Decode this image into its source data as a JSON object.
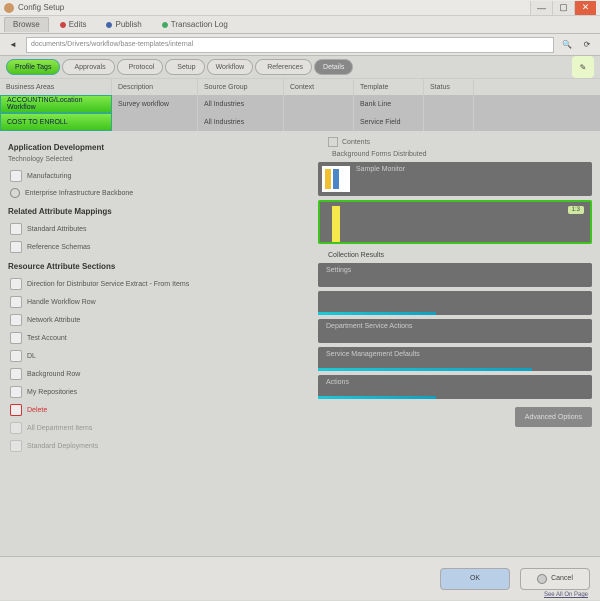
{
  "window": {
    "title": "Config Setup"
  },
  "tabs": [
    {
      "label": "Browse",
      "active": true
    },
    {
      "label": "Edits"
    },
    {
      "label": "Publish"
    },
    {
      "label": "Transaction Log"
    }
  ],
  "address": {
    "value": "documents/Drivers/workflow/base-templates/internal"
  },
  "filters": {
    "items": [
      {
        "label": "Profile Tags",
        "selected": true
      },
      {
        "label": "Approvals"
      },
      {
        "label": "Protocol"
      },
      {
        "label": "Setup"
      },
      {
        "label": "Workflow"
      },
      {
        "label": "References"
      },
      {
        "label": "Details",
        "dark": true
      }
    ]
  },
  "grid": {
    "headers": [
      "Business Areas",
      "Description",
      "Source Group",
      "Context",
      "Template",
      "Status"
    ],
    "rows": [
      {
        "cells": [
          "ACCOUNTING/Location Workflow",
          "Survey workflow",
          "All Industries",
          "",
          "Bank Line",
          ""
        ]
      },
      {
        "cells": [
          "COST TO ENROLL",
          "",
          "All Industries",
          "",
          "Service Field",
          ""
        ]
      }
    ]
  },
  "left": {
    "section1_title": "Application Development",
    "section1_sub": "Technology Selected",
    "opts1": [
      {
        "label": "Manufacturing"
      },
      {
        "label": "Enterprise Infrastructure Backbone"
      }
    ],
    "section2_title": "Related Attribute Mappings",
    "opts2": [
      {
        "label": "Standard Attributes"
      },
      {
        "label": "Reference Schemas"
      }
    ],
    "section3_title": "Resource Attribute Sections",
    "opts3": [
      {
        "label": "Direction for Distributor Service Extract - From Items"
      },
      {
        "label": "Handle Workflow Row"
      },
      {
        "label": "Network Attribute"
      },
      {
        "label": "Test Account"
      },
      {
        "label": "DL"
      },
      {
        "label": "Background Row"
      },
      {
        "label": "My Repositories"
      },
      {
        "label": "Delete",
        "red": true
      },
      {
        "label": "All Department Items"
      },
      {
        "label": "Standard Deployments"
      }
    ]
  },
  "right": {
    "tab_label": "Contents",
    "sub_label": "Background Forms Distributed",
    "thumb_label": "Sample Monitor",
    "badge": "1:3",
    "detail_title": "Collection Results",
    "cards": [
      {
        "label": "Settings"
      },
      {
        "label": ""
      },
      {
        "label": "Department Service Actions"
      },
      {
        "label": "Service Management Defaults"
      },
      {
        "label": "Actions"
      }
    ],
    "small_button": "Advanced Options"
  },
  "footer": {
    "ok": "OK",
    "cancel": "Cancel",
    "link": "See All On Page"
  }
}
